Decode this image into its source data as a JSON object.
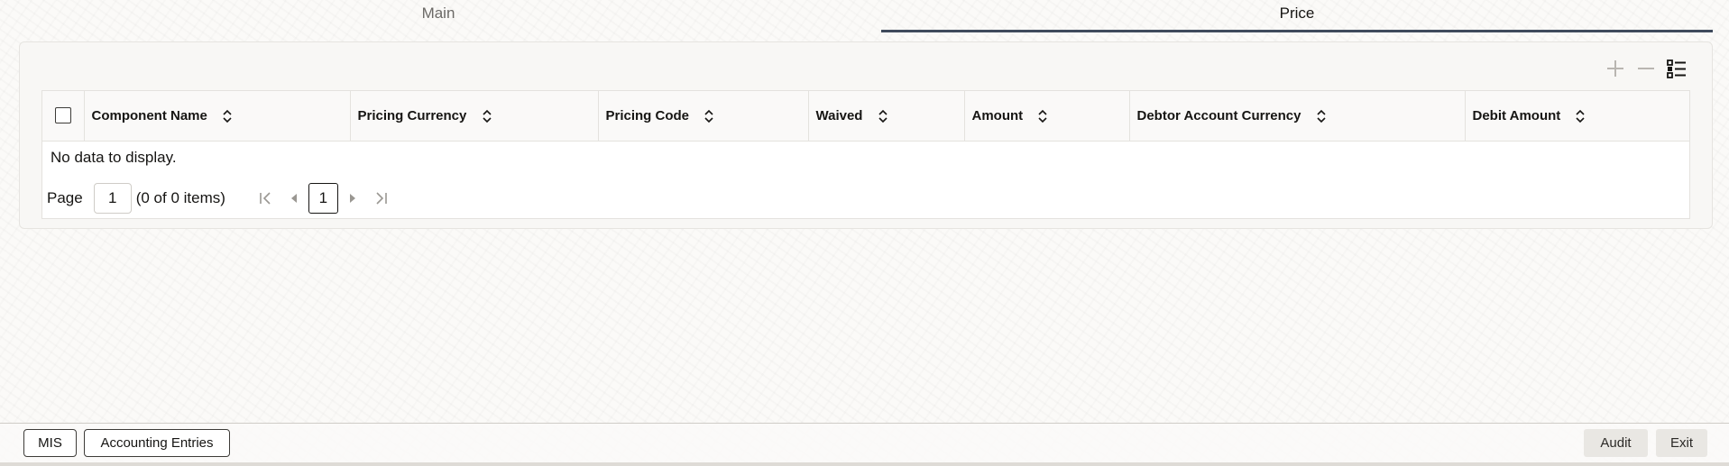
{
  "tabs": [
    {
      "label": "Main",
      "active": false
    },
    {
      "label": "Price",
      "active": true
    }
  ],
  "toolbar": {
    "add_icon": "plus-icon",
    "remove_icon": "minus-icon",
    "columns_icon": "list-settings-icon"
  },
  "table": {
    "columns": [
      "Component Name",
      "Pricing Currency",
      "Pricing Code",
      "Waived",
      "Amount",
      "Debtor Account Currency",
      "Debit Amount"
    ],
    "empty_message": "No data to display."
  },
  "pager": {
    "page_label": "Page",
    "page_value": "1",
    "count_text": "(0 of 0 items)",
    "current_page": "1"
  },
  "footer": {
    "mis_label": "MIS",
    "accounting_label": "Accounting Entries",
    "audit_label": "Audit",
    "exit_label": "Exit"
  },
  "colors": {
    "active_tab_underline": "#3f4a5c",
    "text": "#161513",
    "muted_text": "#6b6966"
  }
}
